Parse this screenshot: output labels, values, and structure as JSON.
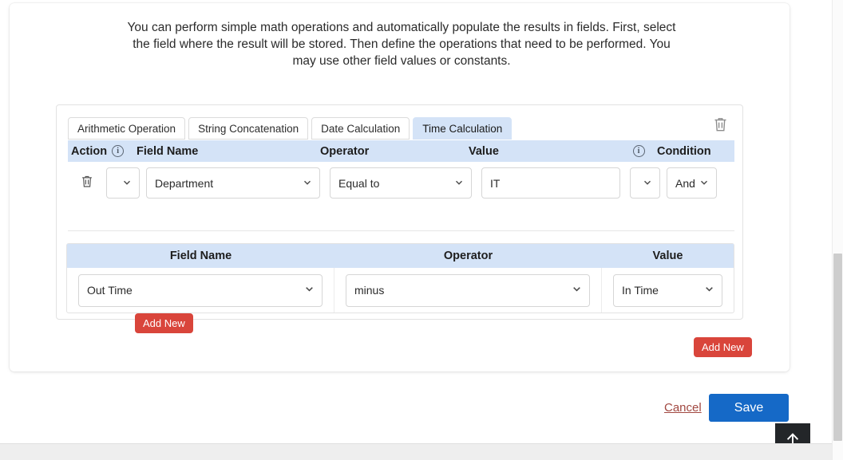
{
  "intro": {
    "text": "You can perform simple math operations and automatically populate the results in fields. First, select the field where the result will be stored. Then define the operations that need to be performed. You may use other field values or constants."
  },
  "panel": {
    "delete_icon": "trash-icon",
    "tabs": [
      {
        "label": "Arithmetic Operation",
        "active": false
      },
      {
        "label": "String Concatenation",
        "active": false
      },
      {
        "label": "Date Calculation",
        "active": false
      },
      {
        "label": "Time Calculation",
        "active": true
      }
    ],
    "condition_table": {
      "headers": {
        "action": "Action",
        "action_info_icon": "info-icon",
        "field_name": "Field Name",
        "operator": "Operator",
        "value": "Value",
        "value_info_icon": "info-icon",
        "condition": "Condition"
      },
      "row": {
        "delete_icon": "trash-icon",
        "action_select": "",
        "field_name": "Department",
        "operator": "Equal to",
        "value": "IT",
        "value_placeholder": "",
        "extra_select": "",
        "condition": "And"
      },
      "add_new_label": "Add New"
    },
    "formula_table": {
      "headers": {
        "field_name": "Field Name",
        "operator": "Operator",
        "value": "Value"
      },
      "row": {
        "field_name": "Out Time",
        "operator": "minus",
        "value": "In Time"
      }
    }
  },
  "footer_actions": {
    "add_new_label": "Add New",
    "cancel_label": "Cancel",
    "save_label": "Save"
  },
  "scroll_top": {
    "icon": "arrow-up-icon"
  },
  "colors": {
    "accent_blue": "#1569c7",
    "header_band": "#d4e3f7",
    "danger_red": "#d9453b",
    "cancel_link": "#a14740",
    "fab_dark": "#232629"
  }
}
